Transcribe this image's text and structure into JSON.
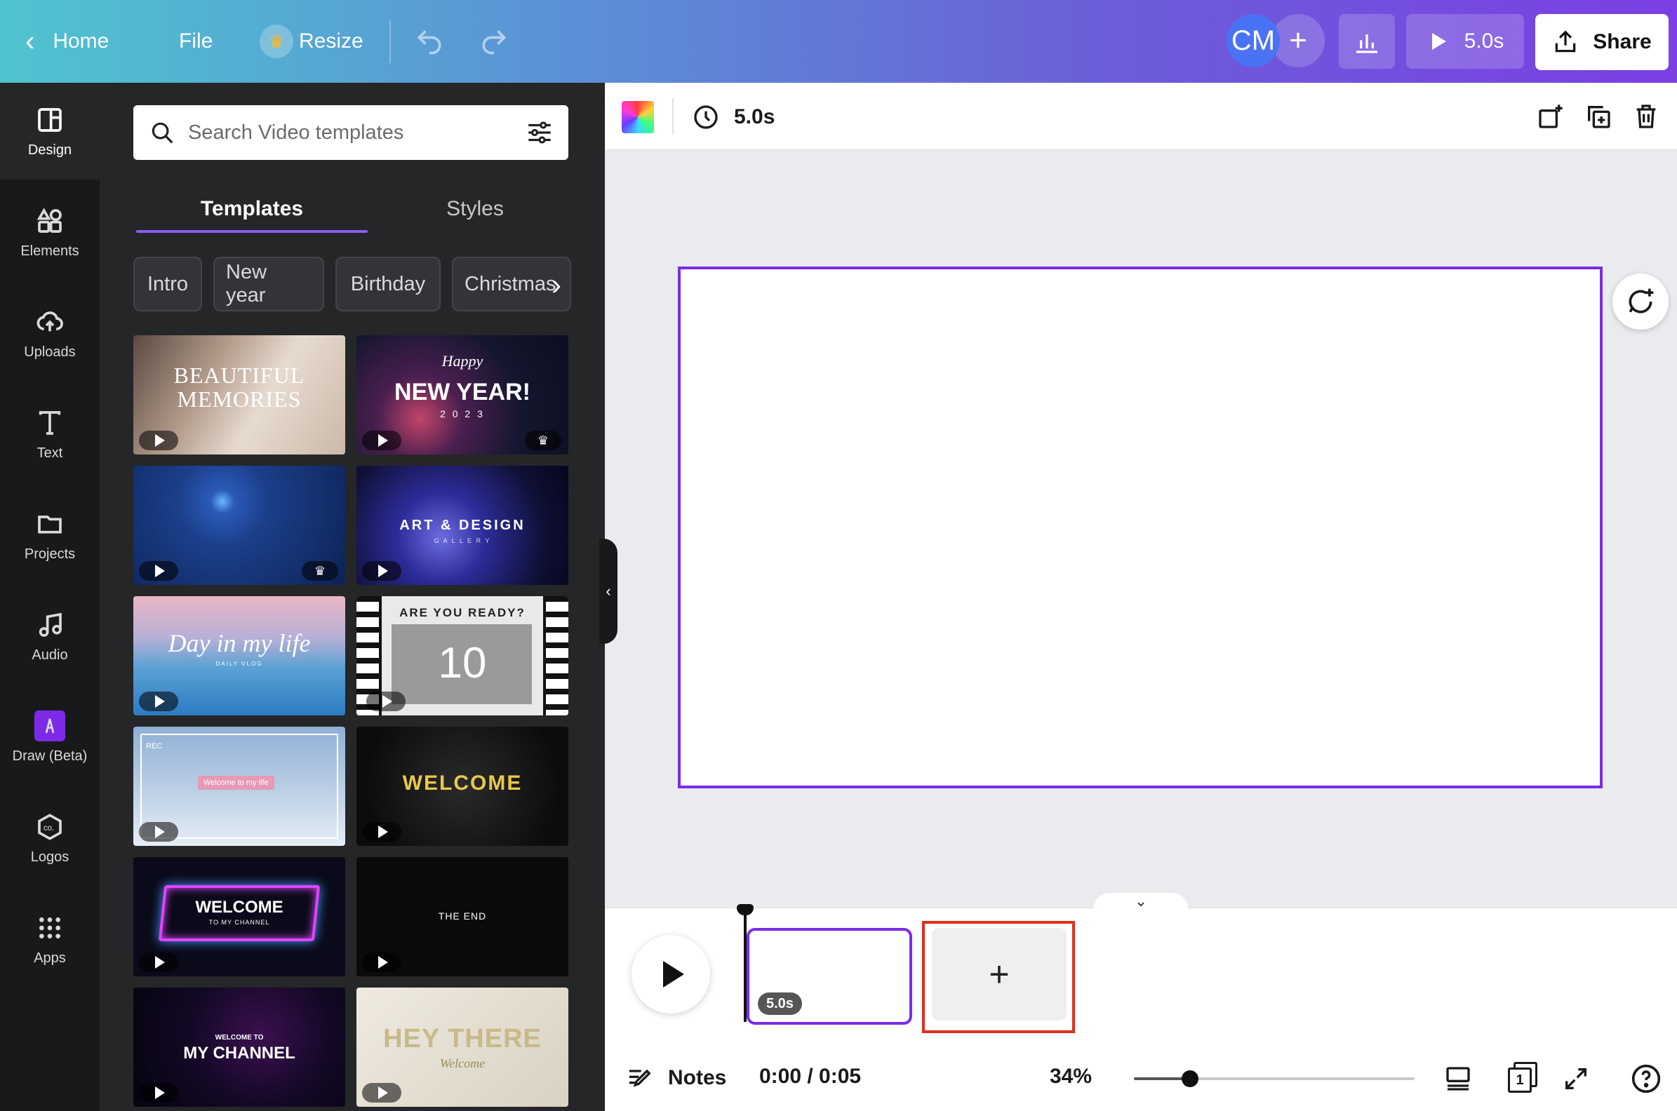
{
  "topbar": {
    "home_label": "Home",
    "file_label": "File",
    "resize_label": "Resize",
    "avatar_initials": "CM",
    "duration_label": "5.0s",
    "share_label": "Share"
  },
  "leftnav": {
    "items": [
      {
        "label": "Design",
        "icon": "design-icon"
      },
      {
        "label": "Elements",
        "icon": "elements-icon"
      },
      {
        "label": "Uploads",
        "icon": "upload-cloud-icon"
      },
      {
        "label": "Text",
        "icon": "text-icon"
      },
      {
        "label": "Projects",
        "icon": "folder-icon"
      },
      {
        "label": "Audio",
        "icon": "music-note-icon"
      },
      {
        "label": "Draw (Beta)",
        "icon": "draw-icon"
      },
      {
        "label": "Logos",
        "icon": "logo-icon"
      },
      {
        "label": "Apps",
        "icon": "apps-grid-icon"
      }
    ]
  },
  "panel": {
    "search_placeholder": "Search Video templates",
    "tabs": [
      "Templates",
      "Styles"
    ],
    "chips": [
      "Intro",
      "New year",
      "Birthday",
      "Christmas"
    ],
    "templates": [
      {
        "title": "BEAUTIFUL MEMORIES",
        "premium": false
      },
      {
        "title": "NEW YEAR!",
        "subtitle": "2 0 2 3",
        "script": "Happy",
        "premium": true
      },
      {
        "title": "",
        "premium": true
      },
      {
        "title": "ART & DESIGN",
        "subtitle": "G A L L E R Y",
        "premium": false
      },
      {
        "title": "Day in my life",
        "subtitle": "DAILY VLOG",
        "premium": false
      },
      {
        "title": "ARE YOU READY?",
        "subtitle": "10",
        "premium": false
      },
      {
        "title": "Welcome to my life",
        "subtitle": "REC",
        "premium": false
      },
      {
        "title": "WELCOME",
        "premium": false
      },
      {
        "title": "WELCOME",
        "subtitle": "TO MY CHANNEL",
        "premium": false
      },
      {
        "title": "THE END",
        "premium": false
      },
      {
        "title": "MY CHANNEL",
        "subtitle": "WELCOME TO",
        "premium": false
      },
      {
        "title": "HEY THERE",
        "subtitle": "Welcome",
        "premium": false
      }
    ]
  },
  "editor": {
    "duration": "5.0s",
    "timeline": {
      "clip_duration": "5.0s",
      "add_page_symbol": "+"
    },
    "footer": {
      "notes_label": "Notes",
      "time": "0:00 / 0:05",
      "zoom": "34%",
      "zoom_fraction": 0.2,
      "page_count": "1"
    }
  },
  "colors": {
    "accent": "#7d2ae8",
    "highlight": "#e0301e"
  }
}
